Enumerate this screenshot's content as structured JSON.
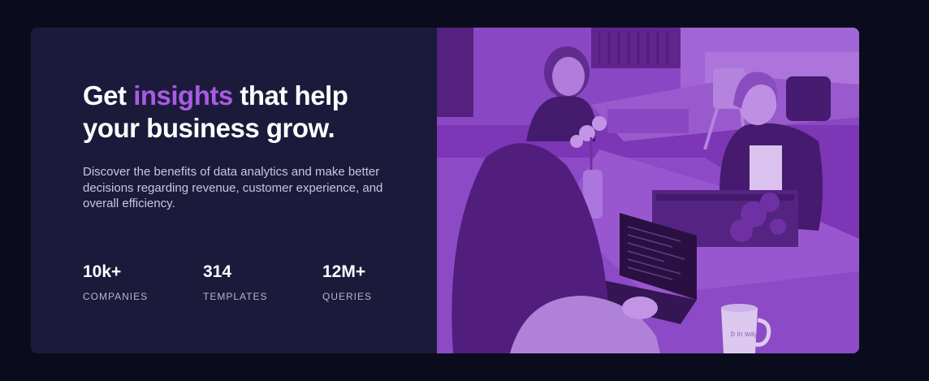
{
  "hero": {
    "headline_pre": "Get",
    "headline_accent": "insights",
    "headline_post": "that help your business grow.",
    "description": "Discover the benefits of data analytics and make better decisions regarding revenue, customer experience, and overall efficiency.",
    "stats": [
      {
        "value": "10k+",
        "label": "COMPANIES"
      },
      {
        "value": "314",
        "label": "TEMPLATES"
      },
      {
        "value": "12M+",
        "label": "QUERIES"
      }
    ]
  },
  "photo": {
    "mug_text": "b in way"
  },
  "colors": {
    "page_bg": "#0a0c1d",
    "card_bg": "#1c1a3b",
    "accent": "#a95be4",
    "photo_tint": "#7d37b8"
  }
}
